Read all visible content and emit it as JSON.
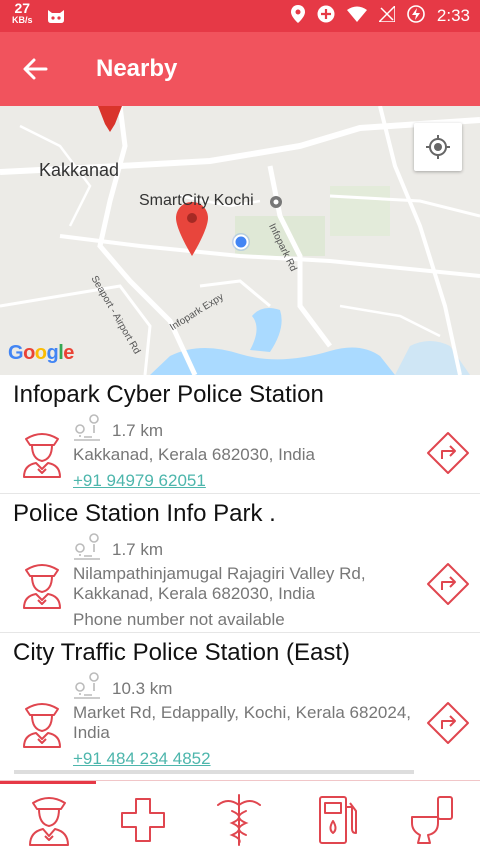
{
  "status_bar": {
    "speed_value": "27",
    "speed_unit": "KB/s",
    "time": "2:33"
  },
  "app_bar": {
    "title": "Nearby"
  },
  "map": {
    "place_labels": {
      "kakkanad": "Kakkanad",
      "smartcity": "SmartCity Kochi",
      "seaport": "Seaport - Airport Rd",
      "infopark_rd": "Infopark Rd",
      "infopark_exp": "Infopark Expy"
    },
    "attribution": "Google"
  },
  "results": [
    {
      "name": "Infopark Cyber Police Station",
      "distance": "1.7 km",
      "address": "Kakkanad, Kerala 682030, India",
      "phone": "+91 94979 62051"
    },
    {
      "name": "Police Station Info Park .",
      "distance": "1.7 km",
      "address": "Nilampathinjamugal Rajagiri Valley Rd, Kakkanad, Kerala 682030, India",
      "phone": "Phone number not available"
    },
    {
      "name": "City Traffic Police Station (East)",
      "distance": "10.3 km",
      "address": "Market Rd, Edappally, Kochi, Kerala 682024, India",
      "phone": "+91 484 234 4852"
    }
  ],
  "bottom_nav": {
    "items": [
      "police",
      "hospital",
      "pharmacy",
      "fuel",
      "toilet"
    ],
    "active": "police"
  },
  "colors": {
    "primary": "#f1535d",
    "status": "#e63946",
    "link": "#4db6ac",
    "map_bg": "#ecebe7",
    "water": "#aadaff"
  }
}
